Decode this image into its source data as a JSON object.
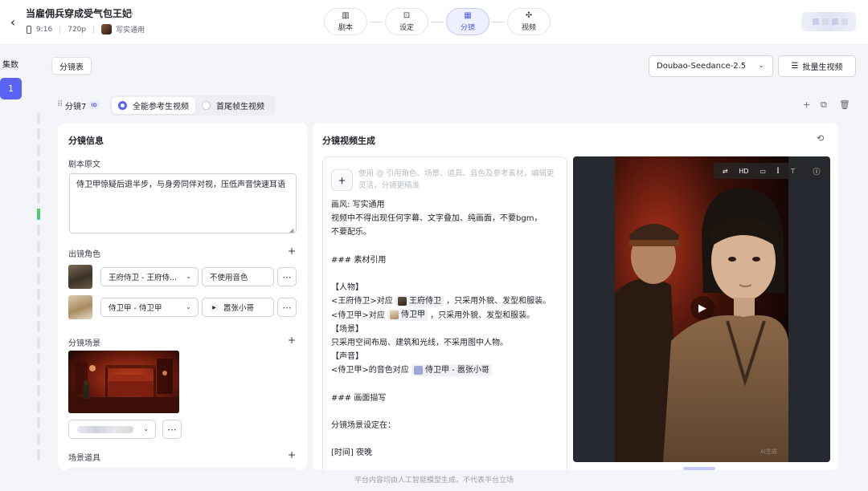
{
  "header": {
    "back_icon": "chevron-left-icon",
    "title": "当雇佣兵穿成受气包王妃",
    "edit_icon": "pencil-icon",
    "ratio": "9:16",
    "resolution": "720p",
    "style": "写实通用",
    "steps": [
      {
        "label": "剧本",
        "icon": "book-icon",
        "active": false
      },
      {
        "label": "设定",
        "icon": "settings-doc-icon",
        "active": false
      },
      {
        "label": "分镜",
        "icon": "grid-icon",
        "active": true
      },
      {
        "label": "视频",
        "icon": "film-icon",
        "active": false
      }
    ]
  },
  "sidebar": {
    "title": "集数",
    "episodes": [
      "1"
    ]
  },
  "toolbar": {
    "storyboard_tab": "分镜表",
    "model": "Doubao-Seedance-2.5",
    "batch_label": "批量生视频"
  },
  "shot": {
    "label": "分镜7",
    "id_badge": "ID",
    "modes": [
      "全能参考生视频",
      "首尾帧生视频"
    ],
    "selected_mode": "全能参考生视频"
  },
  "info_panel": {
    "title": "分镜信息",
    "script_label": "剧本原文",
    "script_text": "侍卫甲惊疑后退半步，与身旁同伴对视，压低声音快速耳语",
    "characters_label": "出镜角色",
    "characters": [
      {
        "name": "王府侍卫 - 王府侍...",
        "voice": "不使用音色",
        "has_voice": false
      },
      {
        "name": "侍卫甲 - 侍卫甲",
        "voice": "嚣张小哥",
        "has_voice": true
      }
    ],
    "scene_label": "分镜场景",
    "props_label": "场景道具"
  },
  "video_panel": {
    "title": "分镜视频生成",
    "placeholder": "使用 @ 引用角色、场景、道具、音色及参考素材，编辑更灵活，分镜更精准",
    "prompt": {
      "l1": "画风: 写实通用",
      "l2": "视频中不得出现任何字幕、文字叠加、纯画面，不要bgm，",
      "l3": "不要配乐。",
      "l4": "### 素材引用",
      "l5": "【人物】",
      "l6a": "<王府侍卫>对应",
      "l6chip": "王府侍卫",
      "l6b": "，只采用外貌、发型和服装。",
      "l7a": "<侍卫甲>对应",
      "l7chip": "侍卫甲",
      "l7b": "，只采用外貌、发型和服装。",
      "l8": "【场景】",
      "l9": "只采用空间布局、建筑和光线，不采用图中人物。",
      "l10": "【声音】",
      "l11a": "<侍卫甲>的音色对应",
      "l11chip": "侍卫甲 - 嚣张小哥",
      "l12": "### 画面描写",
      "l13": "分镜场景设定在：",
      "l14": "[时间] 夜晚"
    },
    "watermark": "AI生成"
  },
  "footer": "平台内容均由人工智能模型生成，不代表平台立场",
  "colors": {
    "accent": "#5b63f5",
    "active_track": "#4ecb71"
  }
}
